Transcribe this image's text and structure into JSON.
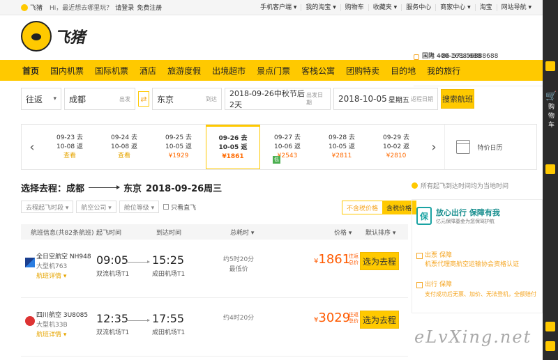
{
  "topbar": {
    "brand": "飞猪",
    "greeting": "Hi，最近想去哪里玩？",
    "login": "请登录",
    "register": "免费注册",
    "links": [
      "手机客户端 ▾",
      "我的淘宝 ▾",
      "购物车",
      "收藏夹 ▾",
      "服务中心",
      "商家中心 ▾",
      "淘宝",
      "网站导航 ▾"
    ]
  },
  "header": {
    "logo_text": "飞猪",
    "hotline_domestic": "国内  400-1688-688",
    "hotline_intl": "国际  +86-571-56888688"
  },
  "nav": [
    "首页",
    "国内机票",
    "国际机票",
    "酒店",
    "旅游度假",
    "出境超市",
    "景点门票",
    "客栈公寓",
    "团购特卖",
    "目的地",
    "我的旅行"
  ],
  "search": {
    "trip_type": "往返",
    "from": "成都",
    "from_hint": "出发",
    "to": "东京",
    "to_hint": "到达",
    "depart": "2018-09-26中秋节后2天",
    "depart_hint": "出发日期",
    "return": "2018-10-05",
    "return_day": "星期五",
    "return_hint": "返程日期",
    "button": "搜索航班"
  },
  "dates": [
    {
      "go": "09-23 去",
      "back": "10-08 返",
      "price": "查看",
      "cls": "gt"
    },
    {
      "go": "09-24 去",
      "back": "10-08 返",
      "price": "查看",
      "cls": "gt"
    },
    {
      "go": "09-25 去",
      "back": "10-05 返",
      "price": "¥1929",
      "cls": "p"
    },
    {
      "go": "09-26 去",
      "back": "10-05 返",
      "price": "¥1861",
      "cls": "p",
      "sel": true
    },
    {
      "go": "09-27 去",
      "back": "10-06 返",
      "price": "¥2543",
      "cls": "p",
      "low": "低"
    },
    {
      "go": "09-28 去",
      "back": "10-05 返",
      "price": "¥2811",
      "cls": "p"
    },
    {
      "go": "09-29 去",
      "back": "10-02 返",
      "price": "¥2810",
      "cls": "p"
    }
  ],
  "calendar_label": "特价日历",
  "title": {
    "prefix": "选择去程：成都",
    "dest": "东京",
    "date": "2018-09-26周三"
  },
  "filters": {
    "depart_time": "去程起飞时段 ▾",
    "airline": "航空公司 ▾",
    "cabin": "舱位等级 ▾",
    "direct_only": "只看直飞",
    "no_tax": "不含税价格",
    "with_tax": "含税价格"
  },
  "thead": {
    "info": "航班信息(共82条航班)",
    "dep": "起飞时间",
    "arr": "到达时间",
    "dur": "总耗时 ▾",
    "price": "价格 ▾",
    "sort": "默认排序 ▾"
  },
  "flights": [
    {
      "airline": "全日空航空 NH948",
      "plane": "大型机763",
      "detail": "航班详情 ▾",
      "dep": "09:05",
      "dep_ap": "双流机场T1",
      "arr": "15:25",
      "arr_ap": "成田机场T1",
      "dur": "约5时20分",
      "tag": "最低价",
      "price": "1861",
      "tax": "往返总价",
      "btn": "选为去程",
      "logo": "ana"
    },
    {
      "airline": "四川航空 3U8085",
      "plane": "大型机33B",
      "detail": "航班详情 ▾",
      "dep": "12:35",
      "dep_ap": "双流机场T1",
      "arr": "17:55",
      "arr_ap": "成田机场T1",
      "dur": "约4时20分",
      "tag": "",
      "price": "3029",
      "tax": "往返总价",
      "btn": "选为去程",
      "logo": "sca"
    }
  ],
  "side": {
    "note": "所有起飞到达时间均为当地时间",
    "title": "放心出行 保障有我",
    "subtitle": "亿元保障基金为您保驾护航",
    "item1_k": "出票 保障",
    "item1_v": "机票代理商航空运输协会资格认证",
    "item2_k": "出行 保障",
    "item2_v": "支付成功后无票、加价、无法登机，全额赔付"
  },
  "rail": {
    "cart": "购物车"
  },
  "watermark": "eLvXing.net"
}
